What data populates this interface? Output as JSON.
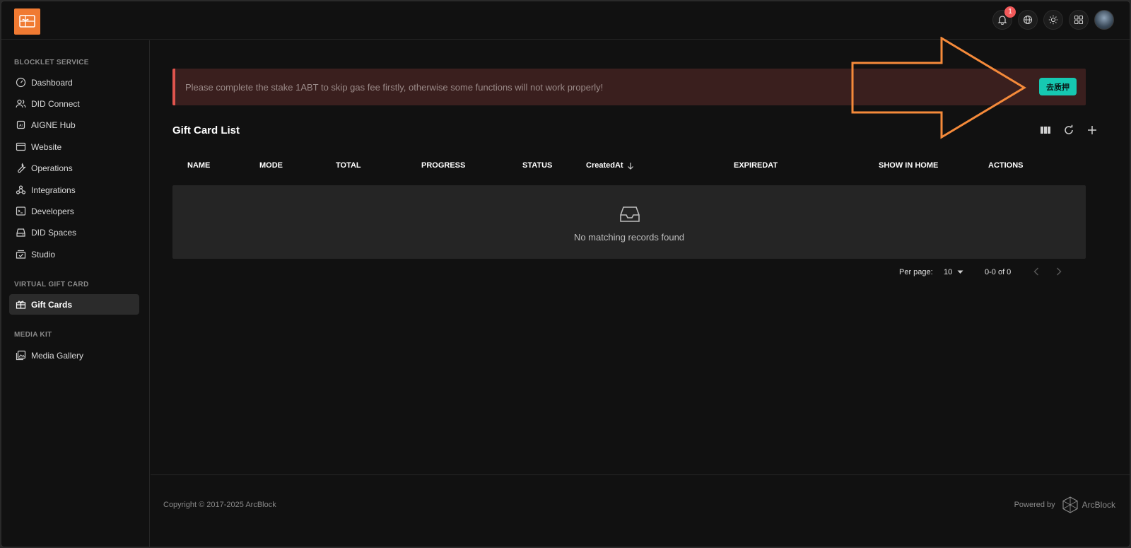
{
  "topbar": {
    "notification_count": "1"
  },
  "sidebar": {
    "sections": [
      {
        "title": "BLOCKLET SERVICE"
      },
      {
        "title": "VIRTUAL GIFT CARD"
      },
      {
        "title": "MEDIA KIT"
      }
    ],
    "items": [
      {
        "label": "Dashboard",
        "icon": "gauge-icon"
      },
      {
        "label": "DID Connect",
        "icon": "users-icon"
      },
      {
        "label": "AIGNE Hub",
        "icon": "ai-chip-icon"
      },
      {
        "label": "Website",
        "icon": "browser-icon"
      },
      {
        "label": "Operations",
        "icon": "wrench-icon"
      },
      {
        "label": "Integrations",
        "icon": "webhook-icon"
      },
      {
        "label": "Developers",
        "icon": "terminal-icon"
      },
      {
        "label": "DID Spaces",
        "icon": "drive-icon"
      },
      {
        "label": "Studio",
        "icon": "box-check-icon"
      },
      {
        "label": "Gift Cards",
        "icon": "gift-icon",
        "active": true
      },
      {
        "label": "Media Gallery",
        "icon": "gallery-icon"
      }
    ]
  },
  "alert": {
    "message": "Please complete the stake 1ABT to skip gas fee firstly, otherwise some functions will not work properly!",
    "button_label": "去质押"
  },
  "list": {
    "title": "Gift Card List",
    "columns": [
      "NAME",
      "MODE",
      "TOTAL",
      "PROGRESS",
      "STATUS",
      "CreatedAt",
      "EXPIREDAT",
      "SHOW IN HOME",
      "ACTIONS"
    ],
    "sort_column": "CreatedAt",
    "sort_direction": "desc",
    "empty_text": "No matching records found"
  },
  "pagination": {
    "per_page_label": "Per page:",
    "per_page_value": "10",
    "range": "0-0 of 0"
  },
  "footer": {
    "copyright": "Copyright © 2017-2025  ArcBlock",
    "powered_by": "Powered by",
    "brand": "ArcBlock"
  },
  "colors": {
    "accent": "#16c8b1",
    "alert_border": "#e0544d",
    "logo": "#f07a32",
    "annotation_arrow": "#f58a3a"
  }
}
